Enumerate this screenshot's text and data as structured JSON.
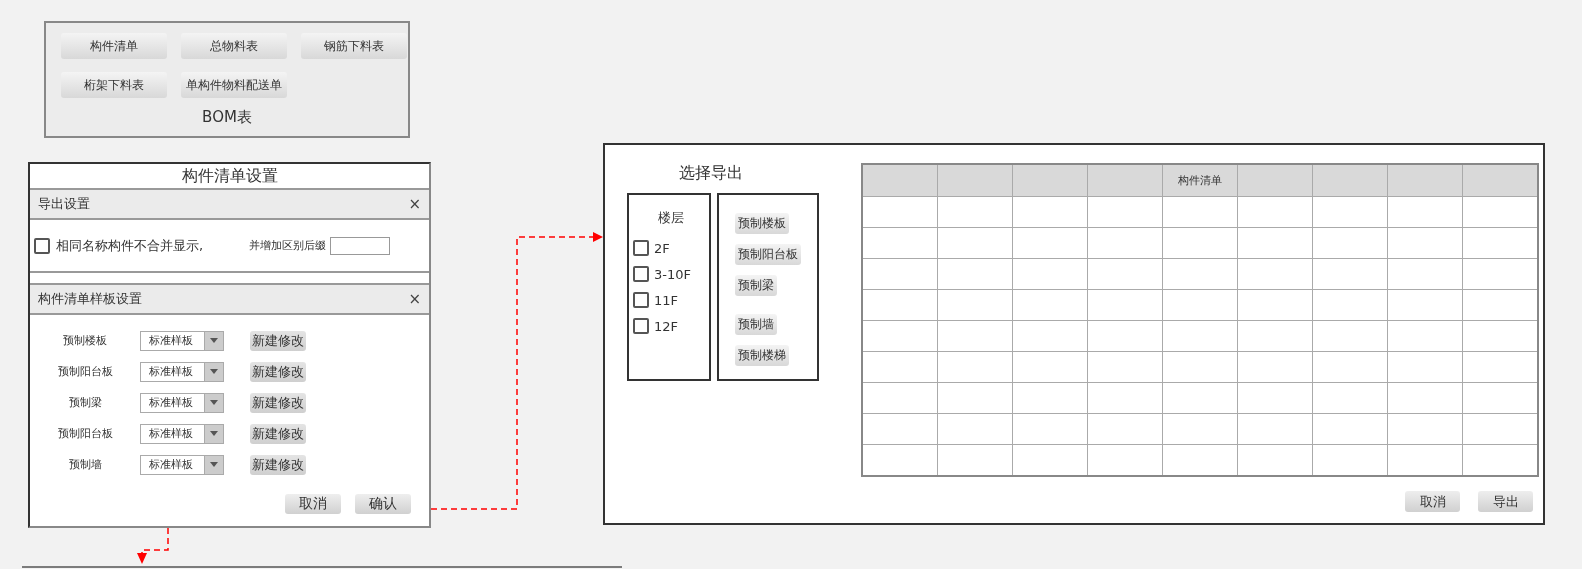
{
  "bom_panel": {
    "title": "BOM表",
    "buttons": [
      "构件清单",
      "总物料表",
      "钢筋下料表",
      "桁架下料表",
      "单构件物料配送单"
    ]
  },
  "settings_dialog": {
    "title": "构件清单设置",
    "export_section": {
      "title": "导出设置",
      "close": "×",
      "checkbox": {
        "label": "相同名称构件不合并显示,",
        "checked": false
      },
      "suffix_label": "并增加区别后缀"
    },
    "template_section": {
      "title": "构件清单样板设置",
      "close": "×",
      "rows": [
        {
          "label": "预制楼板",
          "value": "标准样板",
          "button": "新建修改"
        },
        {
          "label": "预制阳台板",
          "value": "标准样板",
          "button": "新建修改"
        },
        {
          "label": "预制梁",
          "value": "标准样板",
          "button": "新建修改"
        },
        {
          "label": "预制阳台板",
          "value": "标准样板",
          "button": "新建修改"
        },
        {
          "label": "预制墙",
          "value": "标准样板",
          "button": "新建修改"
        }
      ]
    },
    "buttons": [
      "取消",
      "确认"
    ]
  },
  "export_dialog": {
    "title": "选择导出",
    "floors": {
      "title": "楼层",
      "items": [
        {
          "label": "2F",
          "checked": false
        },
        {
          "label": "3-10F",
          "checked": false
        },
        {
          "label": "11F",
          "checked": false
        },
        {
          "label": "12F",
          "checked": false
        }
      ]
    },
    "types": [
      "预制楼板",
      "预制阳台板",
      "预制梁",
      "预制墙",
      "预制楼梯"
    ],
    "table": {
      "title": "构件清单"
    },
    "buttons": [
      "取消",
      "导出"
    ]
  }
}
